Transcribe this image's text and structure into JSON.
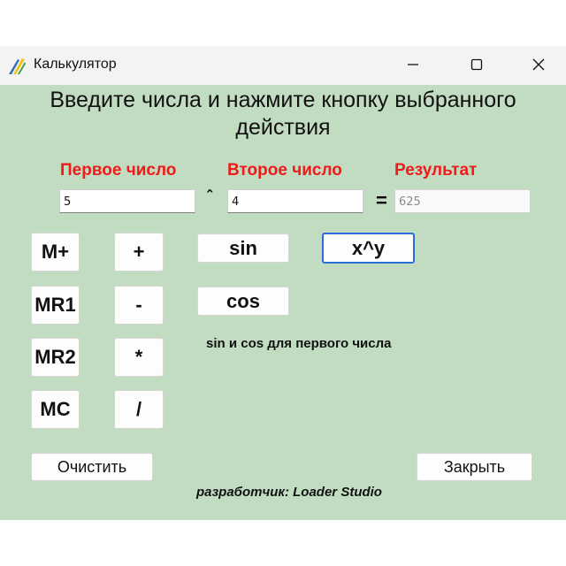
{
  "window": {
    "title": "Калькулятор",
    "colors": {
      "background": "#c1dcc1",
      "label_red": "#ef1a1a",
      "focus_border": "#2a6fd6"
    }
  },
  "instruction": {
    "line1": "Введите числа и нажмите кнопку выбранного",
    "line2": "действия"
  },
  "labels": {
    "first": "Первое число",
    "second": "Второе число",
    "result": "Результат"
  },
  "fields": {
    "first_value": "5",
    "second_value": "4",
    "result_value": "625"
  },
  "operators": {
    "caret": "ˆ",
    "equals": "="
  },
  "memory_buttons": [
    "M+",
    "MR1",
    "MR2",
    "MC"
  ],
  "arith_buttons": [
    "+",
    "-",
    "*",
    "/"
  ],
  "trig_buttons": {
    "sin": "sin",
    "cos": "cos"
  },
  "power_button": "x^y",
  "note": "sin и cos для первого числа",
  "actions": {
    "clear": "Очистить",
    "close": "Закрыть"
  },
  "footer": "разработчик: Loader Studio"
}
